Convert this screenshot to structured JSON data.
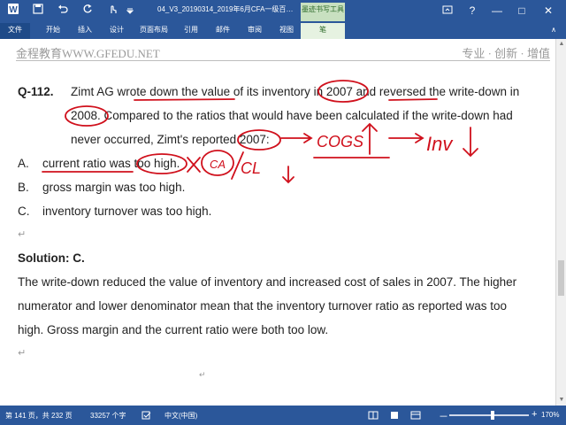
{
  "titlebar": {
    "doc_title": "04_V3_20190314_2019年6月CFA一级百题预...",
    "context_group": "墨迹书写工具",
    "icons": {
      "app": "word-icon",
      "save": "save-icon",
      "undo": "undo-icon",
      "redo": "redo-icon",
      "touch": "touch-mode-icon",
      "more": "dropdown-icon"
    },
    "help_glyph": "?",
    "minimize_glyph": "—",
    "restore_glyph": "□",
    "close_glyph": "✕"
  },
  "ribbon": {
    "tabs": [
      "文件",
      "开始",
      "插入",
      "设计",
      "页面布局",
      "引用",
      "邮件",
      "审阅",
      "视图",
      "笔"
    ],
    "collapse_glyph": "∧"
  },
  "document": {
    "header_left": "金程教育WWW.GFEDU.NET",
    "header_right": "专业 · 创新 · 增值",
    "question": {
      "number": "Q-112.",
      "line1": "Zimt AG wrote down the value of its inventory in 2007 and reversed the write-down in",
      "line2": "2008. Compared to the ratios that would have been calculated if the write-down had",
      "line3": "never occurred, Zimt's reported 2007:",
      "options": [
        {
          "letter": "A.",
          "text": "current ratio was too high."
        },
        {
          "letter": "B.",
          "text": "gross margin was too high."
        },
        {
          "letter": "C.",
          "text": "inventory turnover was too high."
        }
      ]
    },
    "solution_title": "Solution: C.",
    "solution_lines": [
      "The write-down reduced the value of inventory and increased cost of sales in 2007. The higher",
      "numerator and lower denominator mean that the inventory turnover ratio as reported was too",
      "high. Gross margin and the current ratio were both too low."
    ],
    "return_mark": "↵",
    "annotations": {
      "cogs": "COGS",
      "inv": "Inv",
      "ca": "CA",
      "cl": "CL",
      "cross": "X"
    }
  },
  "statusbar": {
    "page": "第 141 页，共 232 页",
    "words": "33257 个字",
    "language": "中文(中国)",
    "zoom": "170%",
    "zoom_minus": "－",
    "zoom_plus": "+"
  },
  "colors": {
    "ribbon": "#2b579a",
    "ink": "#d0101c",
    "context": "#c8e0c0"
  }
}
